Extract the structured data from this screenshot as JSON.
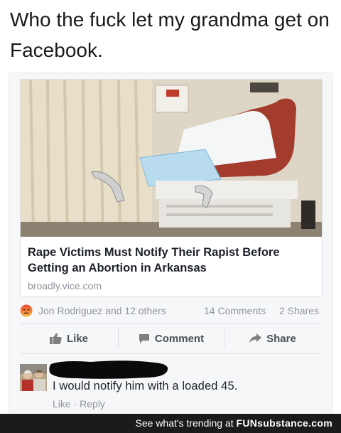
{
  "caption": "Who the fuck let my grandma get on Facebook.",
  "post": {
    "link": {
      "title": "Rape Victims Must Notify Their Rapist Before Getting an Abortion in Arkansas",
      "domain": "broadly.vice.com",
      "image_icon": "exam-room-photo"
    },
    "reactions": {
      "icon": "angry-reaction-icon",
      "names": "Jon Rodriguez and 12 others",
      "comments": "14 Comments",
      "shares": "2 Shares"
    },
    "actions": {
      "like": "Like",
      "comment": "Comment",
      "share": "Share"
    },
    "comment": {
      "text": "I would notify him with a loaded 45.",
      "like": "Like",
      "separator": " · ",
      "reply": "Reply"
    }
  },
  "footer": {
    "prefix": "See what's trending at ",
    "brand": "FUNsubstance.com"
  },
  "colors": {
    "link_blue": "#4b4f56",
    "muted": "#90949c",
    "angry": "#e9710f",
    "footer_bg": "#1b1b1b"
  }
}
